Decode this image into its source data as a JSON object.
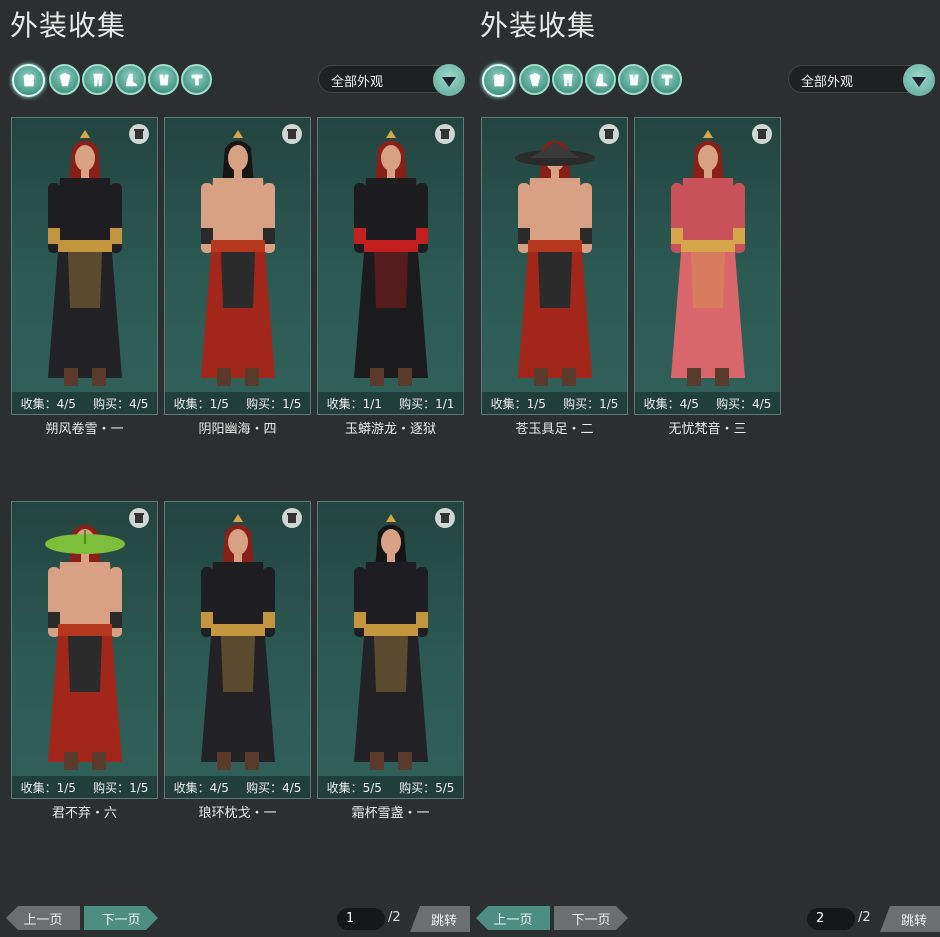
{
  "panels": [
    {
      "title": "外装收集",
      "filter": "全部外观",
      "categories": [
        "body-armor-icon",
        "cape-icon",
        "pants-icon",
        "shoes-icon",
        "gloves-icon",
        "belt-icon"
      ],
      "cards": [
        {
          "name": "朔风卷雪・一",
          "collect": "收集：4/5",
          "buy": "购买：4/5",
          "palette": "dark-gold",
          "hat": "crown",
          "hair": "#8a1f1a"
        },
        {
          "name": "阴阳幽海・四",
          "collect": "收集：1/5",
          "buy": "购买：1/5",
          "palette": "shirtless-red",
          "hat": "crown",
          "hair": "#151515"
        },
        {
          "name": "玉蟒游龙・逐狱",
          "collect": "收集：1/1",
          "buy": "购买：1/1",
          "palette": "black-red-scarf",
          "hat": "crown",
          "hair": "#8a1f1a"
        },
        {
          "name": "君不弃・六",
          "collect": "收集：1/5",
          "buy": "购买：1/5",
          "palette": "shirtless-red",
          "hat": "leaf",
          "hair": "#8a1f1a"
        },
        {
          "name": "琅环枕戈・一",
          "collect": "收集：4/5",
          "buy": "购买：4/5",
          "palette": "dark-gold",
          "hat": "crown",
          "hair": "#8a1f1a"
        },
        {
          "name": "霜杯雪盏・一",
          "collect": "收集：5/5",
          "buy": "购买：5/5",
          "palette": "dark-gold-armor",
          "hat": "crown",
          "hair": "#151515"
        }
      ],
      "pager": {
        "prev": "上一页",
        "next": "下一页",
        "page": "1",
        "total": "/2",
        "jump": "跳转",
        "active": "next"
      }
    },
    {
      "title": "外装收集",
      "filter": "全部外观",
      "categories": [
        "body-armor-icon",
        "cape-icon",
        "pants-icon",
        "shoes-icon",
        "gloves-icon",
        "belt-icon"
      ],
      "cards": [
        {
          "name": "苍玉具足・二",
          "collect": "收集：1/5",
          "buy": "购买：1/5",
          "palette": "shirtless-red",
          "hat": "straw",
          "hair": "#8a1f1a"
        },
        {
          "name": "无忧梵音・三",
          "collect": "收集：4/5",
          "buy": "购买：4/5",
          "palette": "pink-robe",
          "hat": "crown",
          "hair": "#8a1f1a"
        }
      ],
      "pager": {
        "prev": "上一页",
        "next": "下一页",
        "page": "2",
        "total": "/2",
        "jump": "跳转",
        "active": "prev"
      }
    }
  ],
  "colors": {
    "accent": "#4c8f80",
    "background": "#2c2f30",
    "card": "#2c5a53"
  }
}
